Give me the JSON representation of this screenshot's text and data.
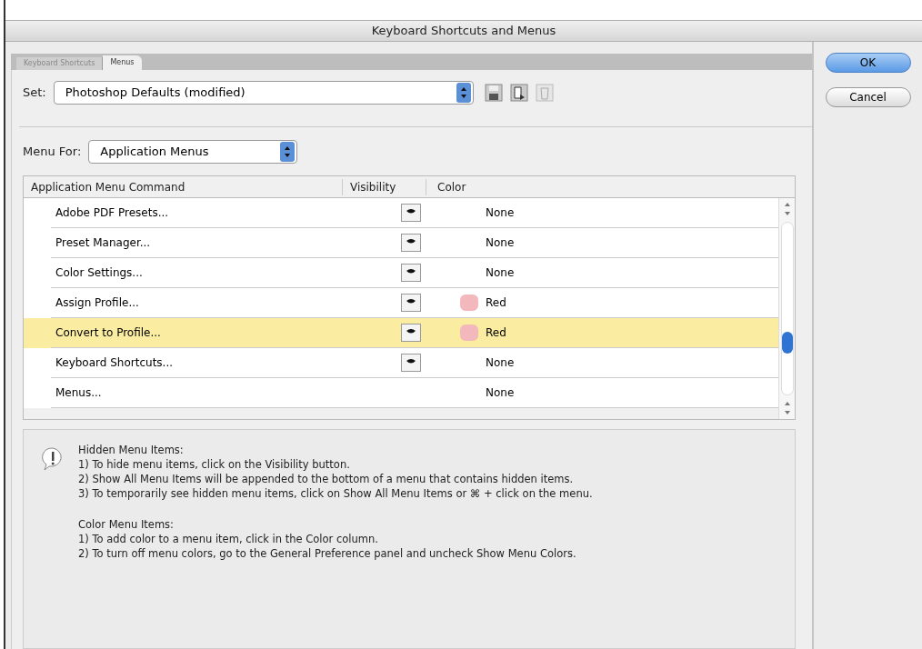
{
  "window": {
    "title": "Keyboard Shortcuts and Menus"
  },
  "tabs": [
    {
      "label": "Keyboard Shortcuts",
      "selected": false
    },
    {
      "label": "Menus",
      "selected": true
    }
  ],
  "set": {
    "label": "Set:",
    "value": "Photoshop Defaults (modified)"
  },
  "menu_for": {
    "label": "Menu For:",
    "value": "Application Menus"
  },
  "table": {
    "columns": [
      "Application Menu Command",
      "Visibility",
      "Color"
    ],
    "rows": [
      {
        "command": "Adobe PDF Presets...",
        "visibility_toggle": true,
        "color_name": "None",
        "selected": false
      },
      {
        "command": "Preset Manager...",
        "visibility_toggle": true,
        "color_name": "None",
        "selected": false
      },
      {
        "command": "Color Settings...",
        "visibility_toggle": true,
        "color_name": "None",
        "selected": false
      },
      {
        "command": "Assign Profile...",
        "visibility_toggle": true,
        "color_name": "Red",
        "color": "#f2b8bb",
        "selected": false
      },
      {
        "command": "Convert to Profile...",
        "visibility_toggle": true,
        "color_name": "Red",
        "color": "#f2b8bb",
        "selected": true
      },
      {
        "command": "Keyboard Shortcuts...",
        "visibility_toggle": true,
        "color_name": "None",
        "selected": false
      },
      {
        "command": "Menus...",
        "visibility_toggle": false,
        "color_name": "None",
        "selected": false
      }
    ]
  },
  "info": {
    "sections": [
      {
        "heading": "Hidden Menu Items:",
        "lines": [
          "1) To hide menu items, click on the Visibility button.",
          "2) Show All Menu Items will be appended to the bottom of a menu that contains hidden items.",
          "3) To temporarily see hidden menu items, click on Show All Menu Items or ⌘ + click on the menu."
        ]
      },
      {
        "heading": "Color Menu Items:",
        "lines": [
          "1) To add color to a menu item, click in the Color column.",
          "2) To turn off menu colors, go to the General Preference panel and uncheck Show Menu Colors."
        ]
      }
    ]
  },
  "buttons": [
    {
      "label": "OK",
      "default": true
    },
    {
      "label": "Cancel",
      "default": false
    }
  ]
}
